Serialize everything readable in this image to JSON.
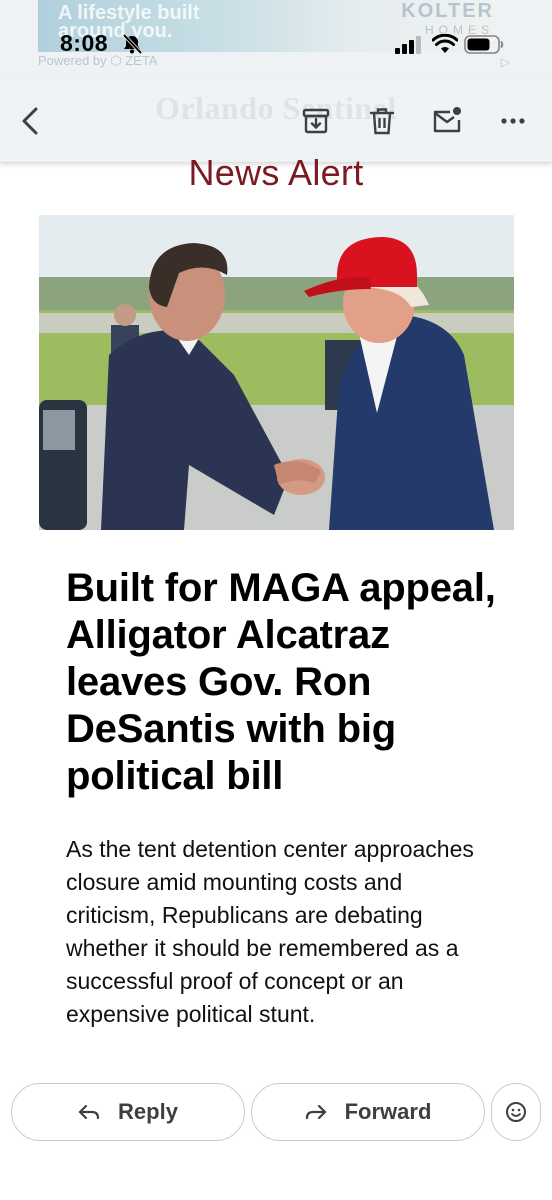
{
  "status_bar": {
    "time": "8:08"
  },
  "ad": {
    "text": "A lifestyle built around you.",
    "brand": "KOLTER",
    "brand_sub": "HOMES",
    "powered_by": "Powered by ⬡ ZETA",
    "info": "▷"
  },
  "email": {
    "masthead": "Orlando Sentinel",
    "alert_label": "News Alert",
    "headline": "Built for MAGA appeal, Alligator Alcatraz leaves Gov. Ron DeSantis with big political bill",
    "dek": "As the tent detention center approaches closure amid mounting costs and criticism, Republicans are debating whether it should be remembered as a successful proof of concept or an expensive political stunt."
  },
  "actions": {
    "reply_label": "Reply",
    "forward_label": "Forward"
  },
  "colors": {
    "alert_red": "#7b1a22",
    "toolbar_bg": "#f0f3f5",
    "button_border": "#c9cdd1"
  },
  "icons": [
    "bell-slash-icon",
    "cellular-signal-icon",
    "wifi-icon",
    "battery-icon",
    "back-arrow-icon",
    "archive-icon",
    "trash-icon",
    "mark-unread-icon",
    "more-dots-icon",
    "reply-arrow-icon",
    "forward-arrow-icon",
    "emoji-reaction-icon"
  ]
}
